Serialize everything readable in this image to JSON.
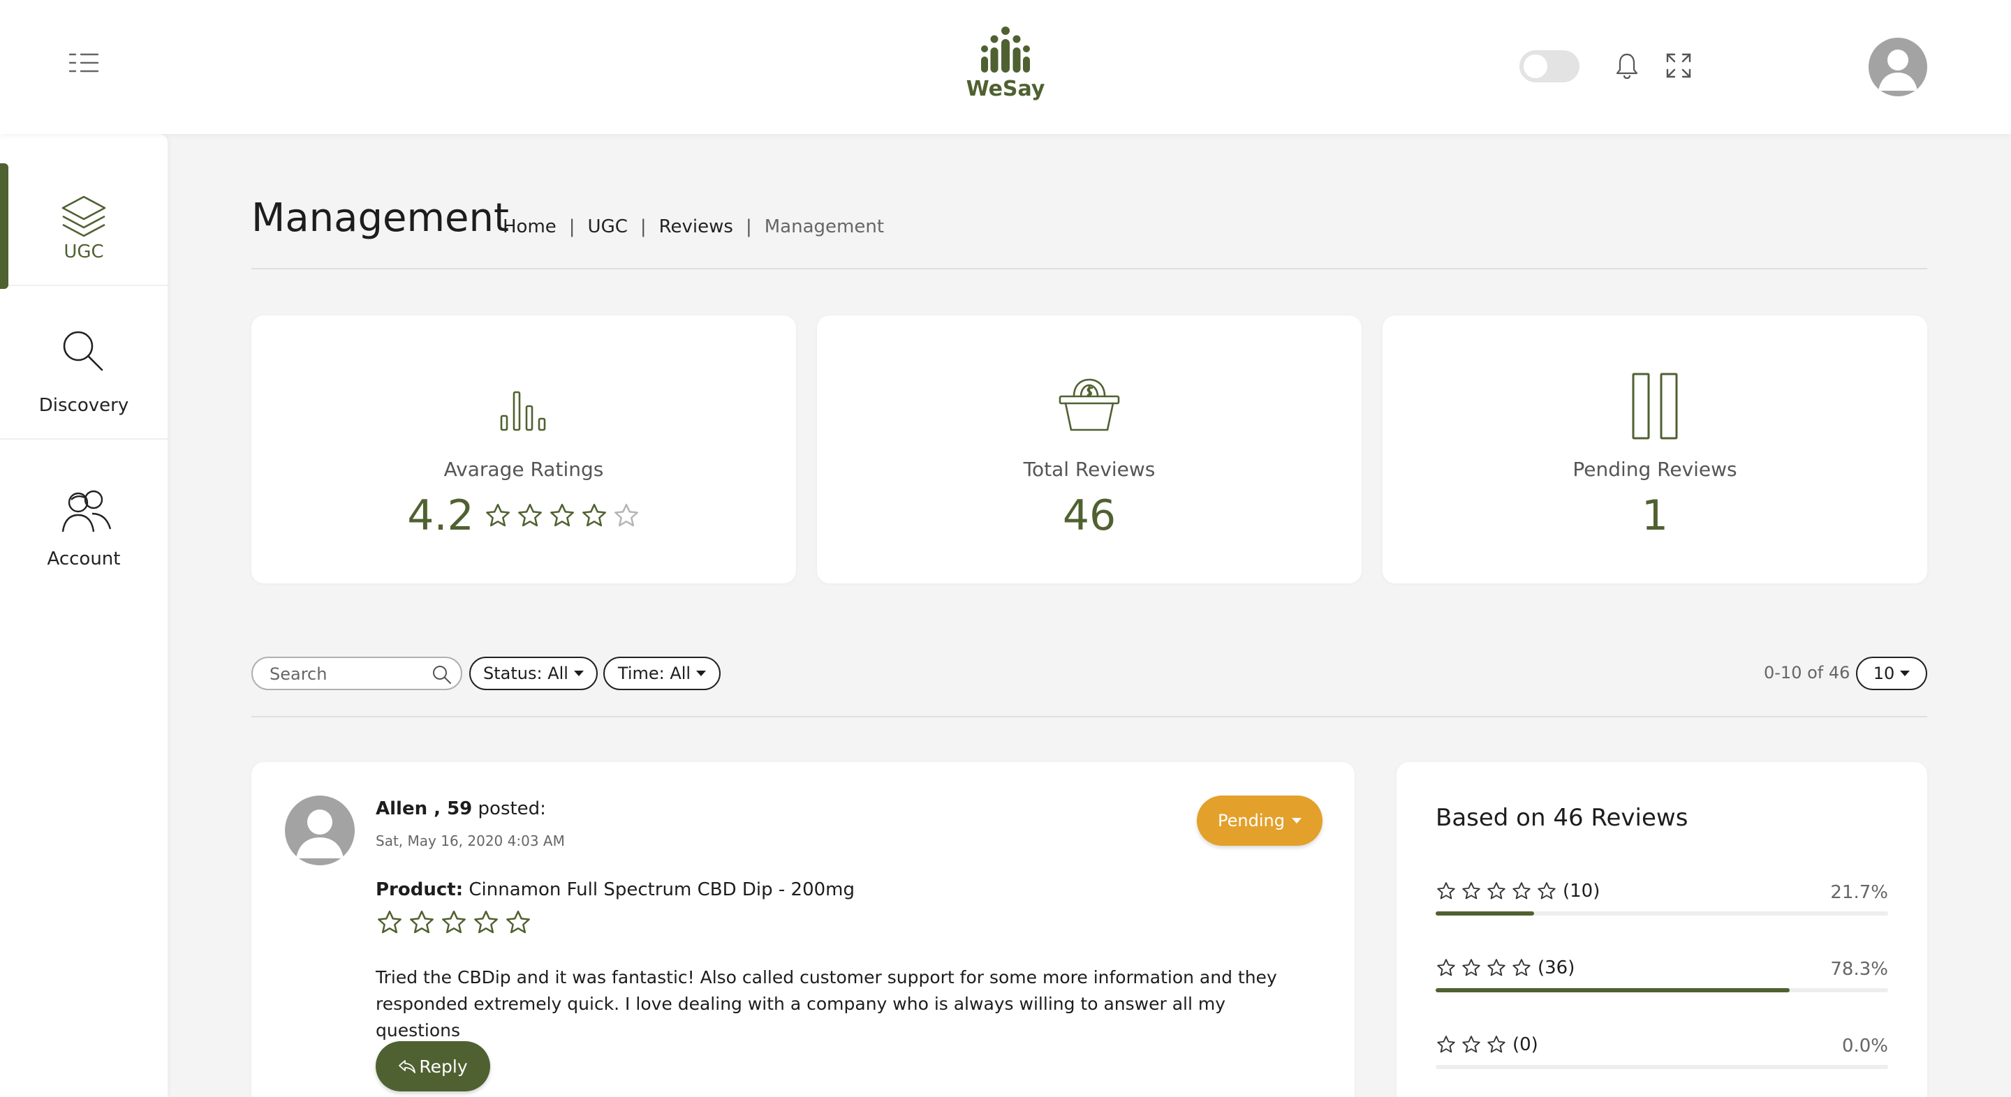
{
  "app": {
    "brand": "WeSay",
    "brand_color": "#4f6131",
    "accent_color": "#e3a02b"
  },
  "header": {
    "menu_icon": "list-menu-icon",
    "theme_toggle_on": false,
    "notification_icon": "bell-icon",
    "fullscreen_icon": "expand-icon",
    "avatar_icon": "user-avatar-icon"
  },
  "sidebar": {
    "items": [
      {
        "label": "UGC",
        "icon": "layers-icon",
        "active": true
      },
      {
        "label": "Discovery",
        "icon": "magnifier-icon",
        "active": false
      },
      {
        "label": "Account",
        "icon": "users-icon",
        "active": false
      }
    ]
  },
  "page": {
    "title": "Management",
    "breadcrumb": [
      "Home",
      "UGC",
      "Reviews",
      "Management"
    ],
    "breadcrumb_separator": "|"
  },
  "stats": [
    {
      "label": "Avarage Ratings",
      "value": "4.2",
      "icon": "bar-chart-icon",
      "rating": 4.2,
      "max": 5
    },
    {
      "label": "Total Reviews",
      "value": "46",
      "icon": "basket-icon"
    },
    {
      "label": "Pending Reviews",
      "value": "1",
      "icon": "pause-icon"
    }
  ],
  "filters": {
    "search_placeholder": "Search",
    "status_label": "Status: All",
    "time_label": "Time: All",
    "pagination_text": "0-10 of 46",
    "page_size": "10"
  },
  "review": {
    "author_name": "Allen , 59",
    "author_suffix": " posted:",
    "date": "Sat, May 16, 2020 4:03 AM",
    "status": "Pending",
    "product_label": "Product:",
    "product_name": " Cinnamon Full Spectrum CBD Dip - 200mg",
    "rating": 5,
    "text": "Tried the CBDip and it was fantastic! Also called customer support for some more information and they responded extremely quick. I love dealing with a company who is always willing to answer all my questions",
    "reply_label": "Reply",
    "reply_icon": "reply-arrow-icon"
  },
  "summary": {
    "title": "Based on 46 Reviews",
    "rows": [
      {
        "stars": 5,
        "count": "(10)",
        "percent": "21.7%",
        "fraction": 0.217
      },
      {
        "stars": 4,
        "count": "(36)",
        "percent": "78.3%",
        "fraction": 0.783
      },
      {
        "stars": 3,
        "count": "(0)",
        "percent": "0.0%",
        "fraction": 0.0
      }
    ]
  }
}
